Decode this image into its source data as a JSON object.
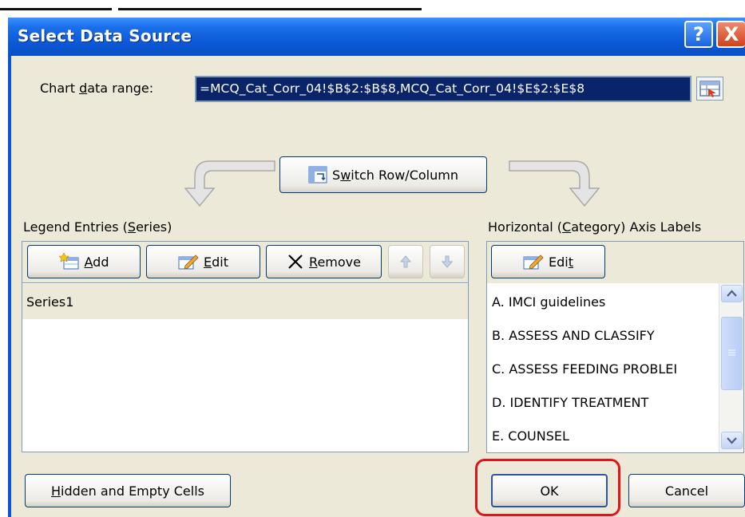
{
  "window": {
    "title": "Select Data Source",
    "help_label": "?",
    "close_label": "X"
  },
  "chart_range": {
    "label_pre": "Chart ",
    "label_u": "d",
    "label_post": "ata range:",
    "value": "=MCQ_Cat_Corr_04!$B$2:$B$8,MCQ_Cat_Corr_04!$E$2:$E$8"
  },
  "switch_button": {
    "pre": "S",
    "u": "w",
    "post": "itch Row/Column"
  },
  "legend": {
    "label_pre": "Legend Entries (",
    "label_u": "S",
    "label_post": "eries)",
    "add": {
      "u": "A",
      "post": "dd"
    },
    "edit": {
      "u": "E",
      "post": "dit"
    },
    "remove": {
      "u": "R",
      "post": "emove"
    },
    "series": [
      "Series1"
    ]
  },
  "axis": {
    "label_pre": "Horizontal (",
    "label_u": "C",
    "label_post": "ategory) Axis Labels",
    "edit": {
      "pre": "Edi",
      "u": "t"
    },
    "items": [
      "A. IMCI guidelines",
      "B. ASSESS AND CLASSIFY",
      "C. ASSESS FEEDING PROBLEI",
      "D. IDENTIFY TREATMENT",
      "E. COUNSEL"
    ]
  },
  "footer": {
    "hidden": {
      "u": "H",
      "post": "idden and Empty Cells"
    },
    "ok": "OK",
    "cancel": "Cancel"
  },
  "colors": {
    "titlebar": "#0b57d6",
    "dialog_bg": "#ece9d8",
    "selection": "#0a246a",
    "highlight": "#e0141a"
  }
}
